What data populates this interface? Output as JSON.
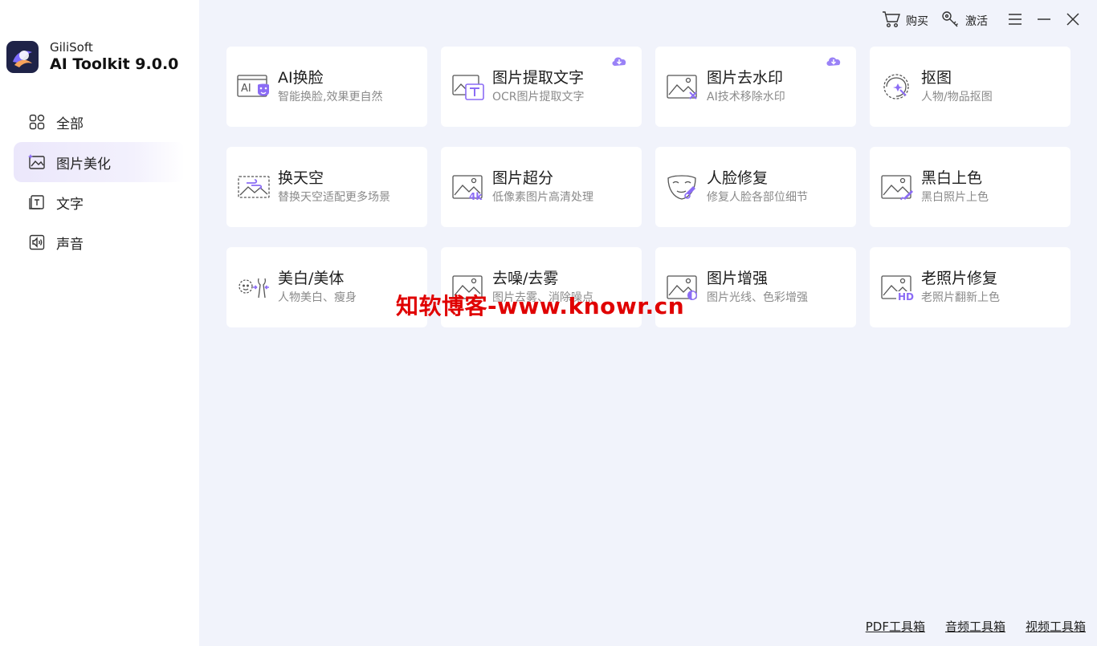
{
  "brand": {
    "company": "GiliSoft",
    "product": "AI Toolkit 9.0.0"
  },
  "topbar": {
    "buy_label": "购买",
    "activate_label": "激活"
  },
  "sidebar": {
    "items": [
      {
        "label": "全部",
        "icon": "grid-icon",
        "active": false
      },
      {
        "label": "图片美化",
        "icon": "image-icon",
        "active": true
      },
      {
        "label": "文字",
        "icon": "text-icon",
        "active": false
      },
      {
        "label": "声音",
        "icon": "audio-icon",
        "active": false
      }
    ]
  },
  "tools": [
    {
      "title": "AI换脸",
      "desc": "智能换脸,效果更自然",
      "icon": "face-swap-icon",
      "cloud": false
    },
    {
      "title": "图片提取文字",
      "desc": "OCR图片提取文字",
      "icon": "ocr-icon",
      "cloud": true
    },
    {
      "title": "图片去水印",
      "desc": "AI技术移除水印",
      "icon": "remove-watermark-icon",
      "cloud": true
    },
    {
      "title": "抠图",
      "desc": "人物/物品抠图",
      "icon": "cutout-icon",
      "cloud": false
    },
    {
      "title": "换天空",
      "desc": "替换天空适配更多场景",
      "icon": "sky-replace-icon",
      "cloud": false
    },
    {
      "title": "图片超分",
      "desc": "低像素图片高清处理",
      "icon": "super-resolution-icon",
      "cloud": false
    },
    {
      "title": "人脸修复",
      "desc": "修复人脸各部位细节",
      "icon": "face-restore-icon",
      "cloud": false
    },
    {
      "title": "黑白上色",
      "desc": "黑白照片上色",
      "icon": "colorize-icon",
      "cloud": false
    },
    {
      "title": "美白/美体",
      "desc": "人物美白、瘦身",
      "icon": "beautify-icon",
      "cloud": false
    },
    {
      "title": "去噪/去雾",
      "desc": "图片去雾、消除噪点",
      "icon": "denoise-icon",
      "cloud": false
    },
    {
      "title": "图片增强",
      "desc": "图片光线、色彩增强",
      "icon": "enhance-icon",
      "cloud": false
    },
    {
      "title": "老照片修复",
      "desc": "老照片翻新上色",
      "icon": "old-photo-icon",
      "cloud": false
    }
  ],
  "watermark": "知软博客-www.knowr.cn",
  "footer": {
    "pdf": "PDF工具箱",
    "audio": "音频工具箱",
    "video": "视频工具箱"
  },
  "colors": {
    "accent": "#8b6cf5",
    "background": "#f1f3fb",
    "watermark": "#e00000"
  }
}
